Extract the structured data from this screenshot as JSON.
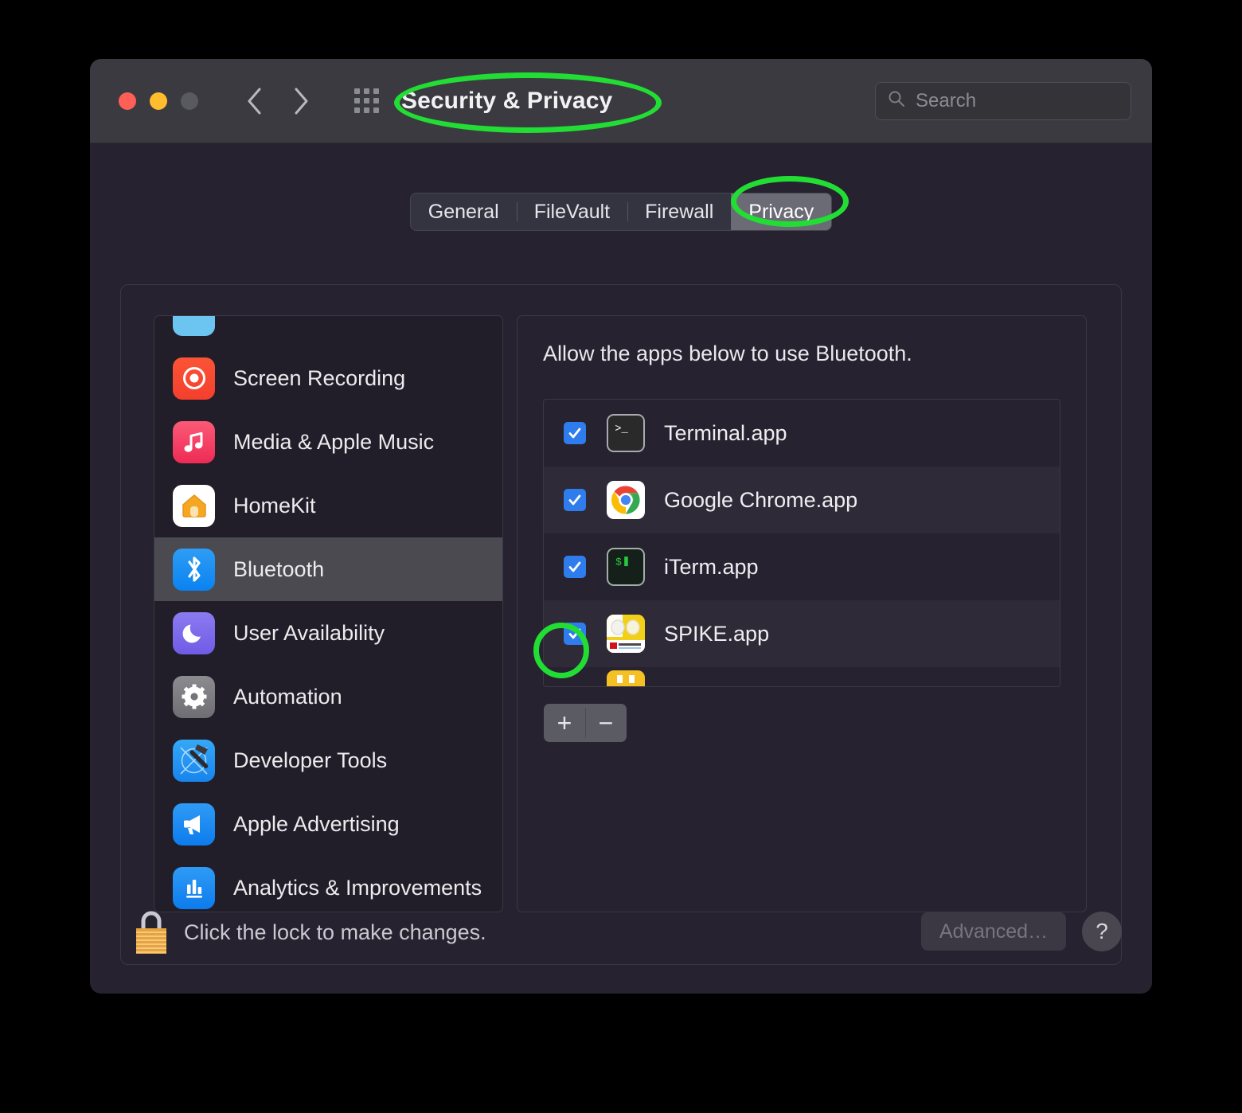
{
  "window": {
    "title": "Security & Privacy",
    "traffic_lights": [
      "close",
      "minimize",
      "zoom"
    ],
    "back_label": "Back",
    "forward_label": "Forward",
    "show_all_label": "Show All",
    "search": {
      "placeholder": "Search",
      "value": ""
    }
  },
  "tabs": [
    {
      "label": "General",
      "active": false
    },
    {
      "label": "FileVault",
      "active": false
    },
    {
      "label": "Firewall",
      "active": false
    },
    {
      "label": "Privacy",
      "active": true
    }
  ],
  "sidebar": {
    "items": [
      {
        "label": "",
        "icon": "partial-blue-icon",
        "selected": false,
        "partial": true
      },
      {
        "label": "Screen Recording",
        "icon": "screen-recording-icon",
        "selected": false
      },
      {
        "label": "Media & Apple Music",
        "icon": "media-music-icon",
        "selected": false
      },
      {
        "label": "HomeKit",
        "icon": "homekit-icon",
        "selected": false
      },
      {
        "label": "Bluetooth",
        "icon": "bluetooth-icon",
        "selected": true
      },
      {
        "label": "User Availability",
        "icon": "moon-icon",
        "selected": false
      },
      {
        "label": "Automation",
        "icon": "gear-icon",
        "selected": false
      },
      {
        "label": "Developer Tools",
        "icon": "xcode-hammer-icon",
        "selected": false
      },
      {
        "label": "Apple Advertising",
        "icon": "megaphone-icon",
        "selected": false
      },
      {
        "label": "Analytics & Improvements",
        "icon": "bar-chart-icon",
        "selected": false
      }
    ]
  },
  "panel": {
    "heading": "Allow the apps below to use Bluetooth.",
    "apps": [
      {
        "name": "Terminal.app",
        "checked": true,
        "icon": "terminal-app-icon"
      },
      {
        "name": "Google Chrome.app",
        "checked": true,
        "icon": "chrome-app-icon"
      },
      {
        "name": "iTerm.app",
        "checked": true,
        "icon": "iterm-app-icon"
      },
      {
        "name": "SPIKE.app",
        "checked": true,
        "icon": "spike-app-icon"
      },
      {
        "name": "",
        "checked": false,
        "icon": "yellow-app-icon",
        "partial": true
      }
    ],
    "add_label": "+",
    "remove_label": "−"
  },
  "bottom": {
    "lock_text": "Click the lock to make changes.",
    "advanced_label": "Advanced…",
    "help_label": "?"
  },
  "colors": {
    "accent_blue": "#2f7ced",
    "annotation_green": "#22dd33",
    "window_bg": "#262230",
    "titlebar_bg": "#3a3a40",
    "selected_row": "#4a4a50"
  }
}
